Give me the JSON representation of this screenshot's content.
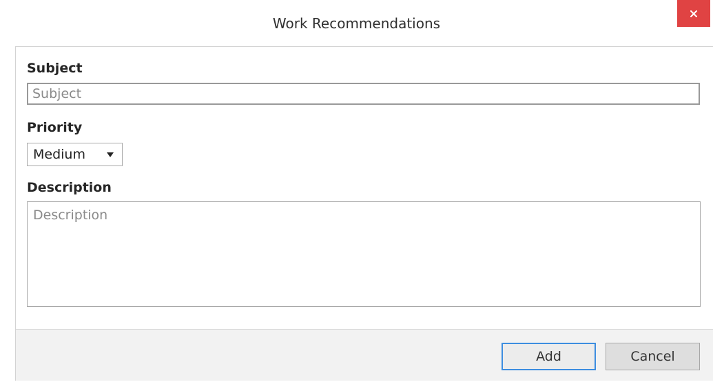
{
  "dialog": {
    "title": "Work Recommendations",
    "close_label": "×"
  },
  "form": {
    "subject": {
      "label": "Subject",
      "value": "",
      "placeholder": "Subject"
    },
    "priority": {
      "label": "Priority",
      "selected": "Medium"
    },
    "description": {
      "label": "Description",
      "value": "",
      "placeholder": "Description"
    }
  },
  "footer": {
    "add_label": "Add",
    "cancel_label": "Cancel"
  },
  "colors": {
    "close_button_bg": "#e04343",
    "primary_button_border": "#3c8de0",
    "footer_bg": "#f2f2f2"
  },
  "icons": {
    "close": "close-icon",
    "dropdown": "caret-down-icon"
  }
}
